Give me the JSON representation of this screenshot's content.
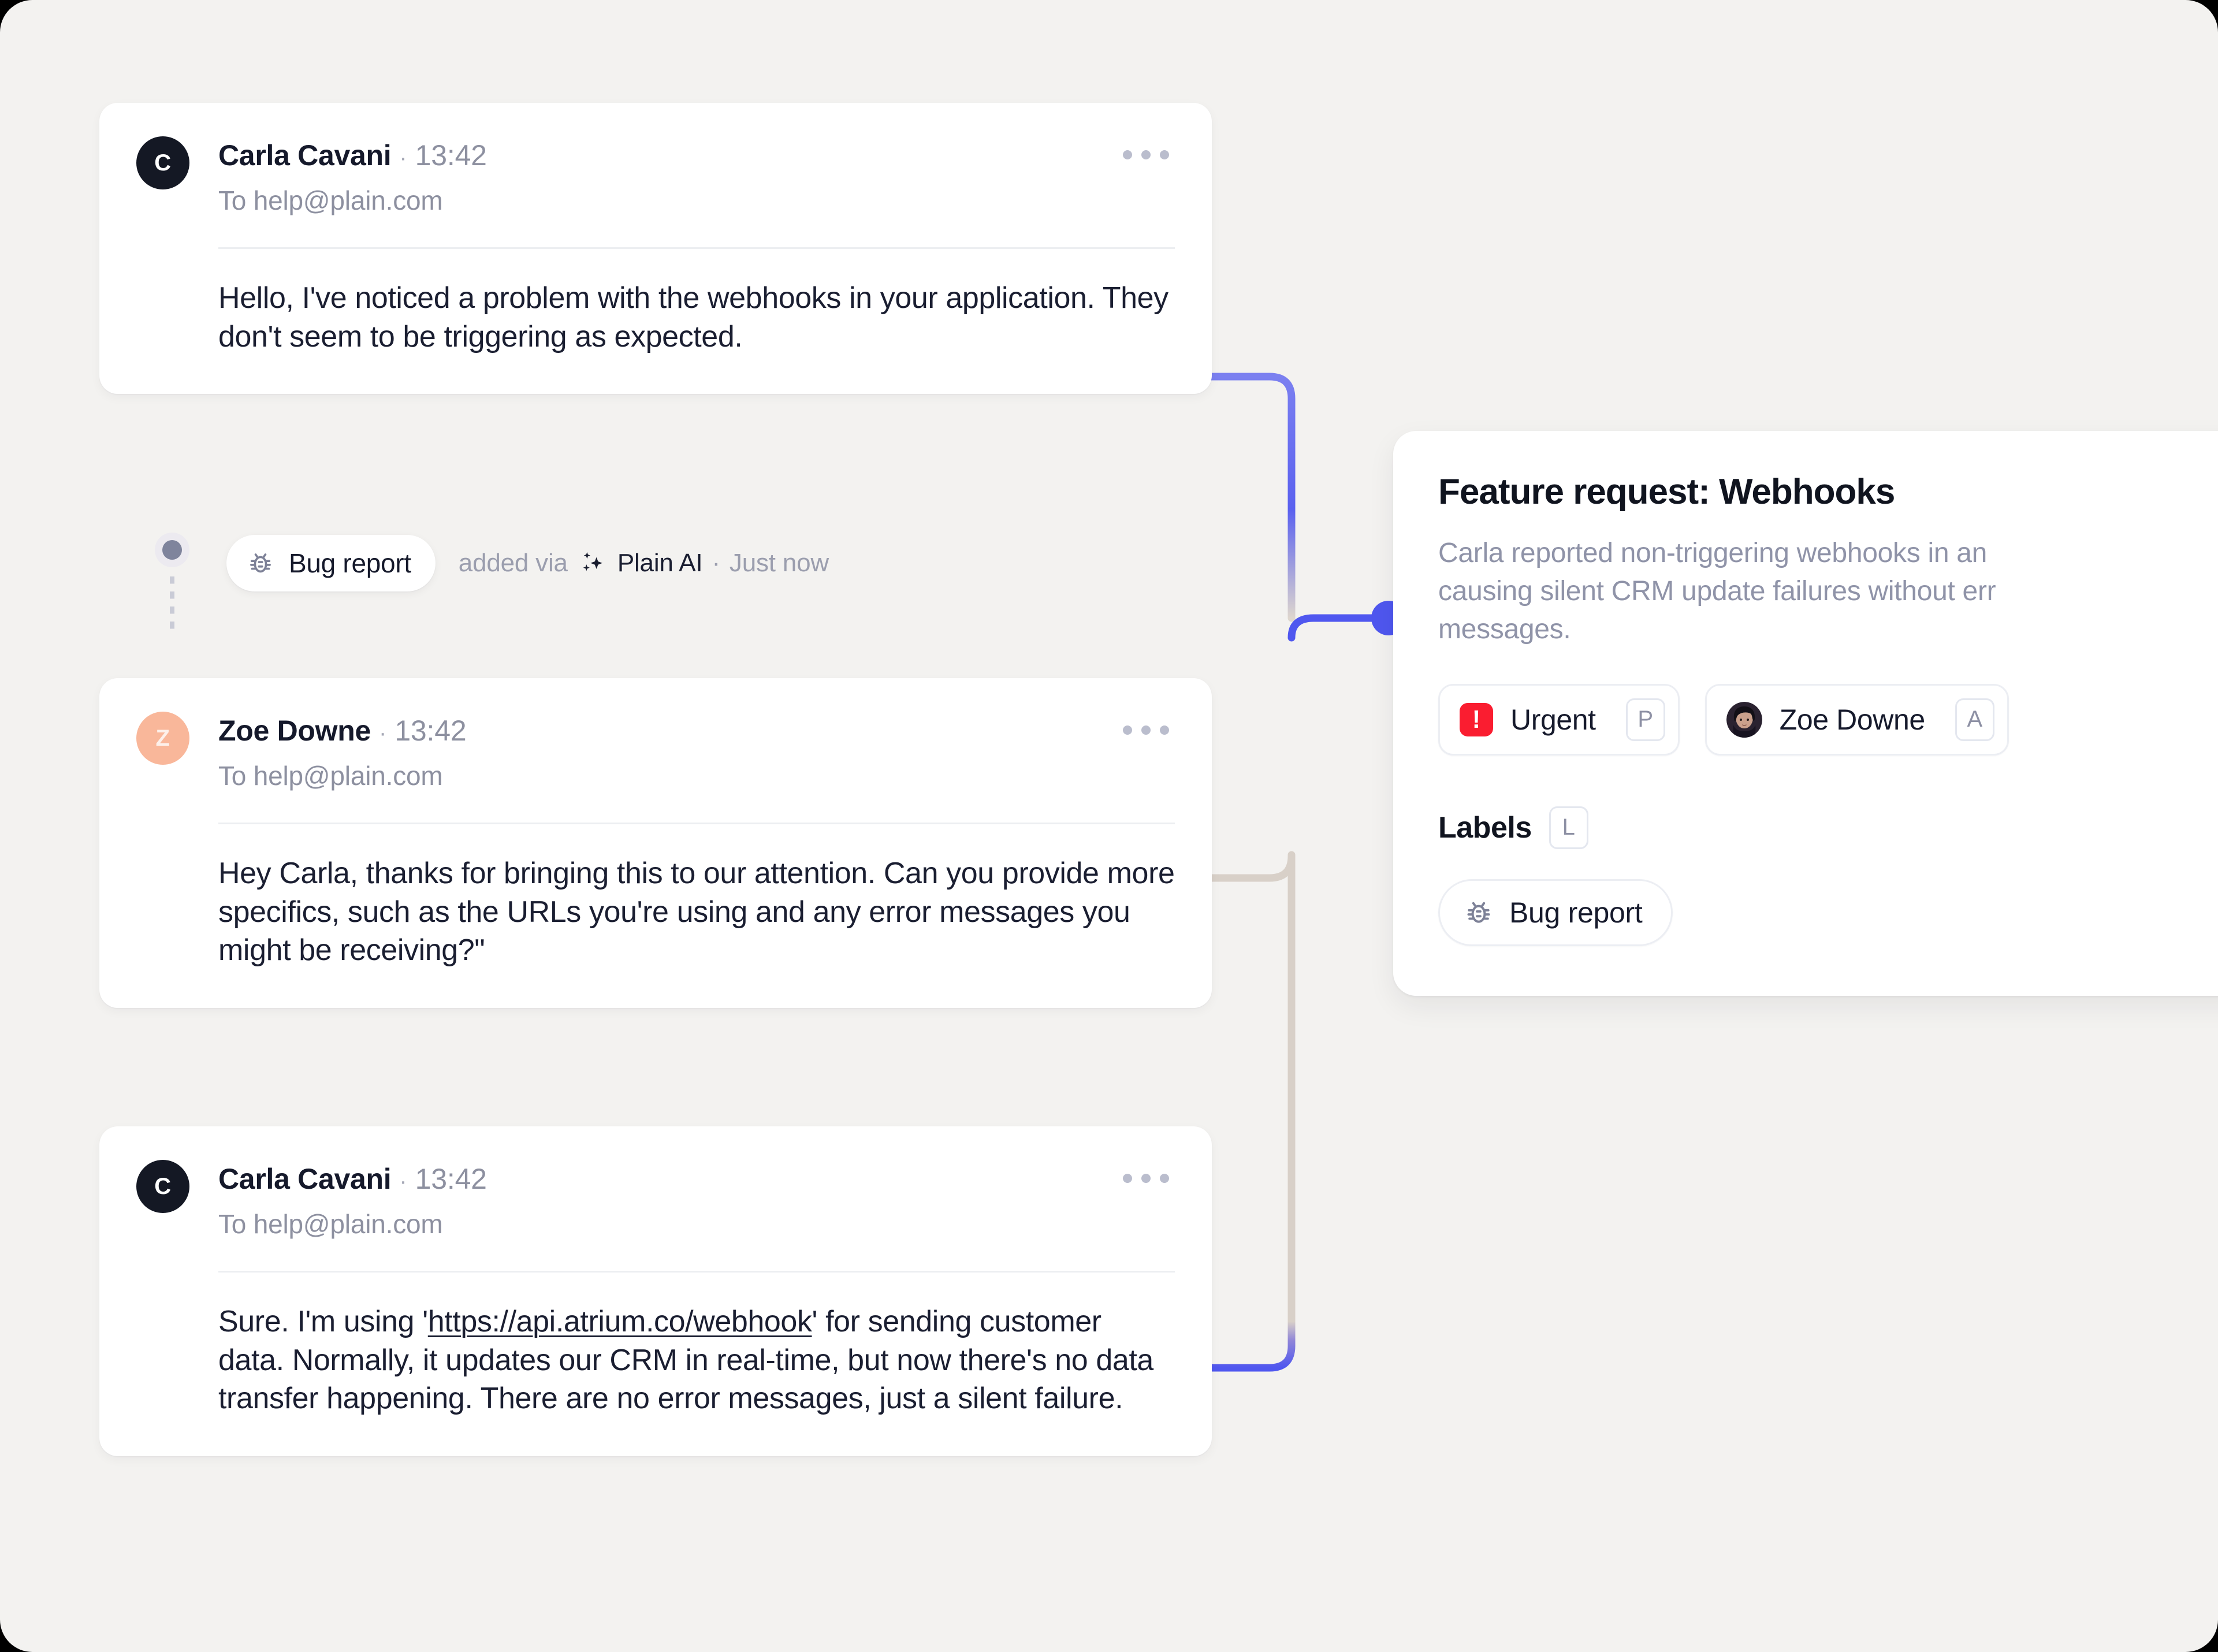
{
  "theme": {
    "canvas_bg": "#f3f2f0",
    "card_bg": "#ffffff",
    "accent_blue": "#4f57ef",
    "connector_neutral": "#d6cfc8",
    "urgent_red": "#fa1d30",
    "muted_text": "#8d90a0"
  },
  "thread": {
    "messages": [
      {
        "avatar_initial": "C",
        "avatar_style": "dark",
        "sender": "Carla Cavani",
        "separator": "·",
        "time": "13:42",
        "recipient": "To help@plain.com",
        "body_before": "Hello, I've noticed a problem with the webhooks in your application. They don't seem to be triggering as expected.",
        "link_text": "",
        "body_after": "",
        "menu_label": "More actions"
      },
      {
        "avatar_initial": "Z",
        "avatar_style": "peach",
        "sender": "Zoe Downe",
        "separator": "·",
        "time": "13:42",
        "recipient": "To help@plain.com",
        "body_before": "Hey Carla, thanks for bringing this to our attention. Can you provide more specifics, such as the URLs you're using and any error messages you might be receiving?\"",
        "link_text": "",
        "body_after": "",
        "menu_label": "More actions"
      },
      {
        "avatar_initial": "C",
        "avatar_style": "dark",
        "sender": "Carla Cavani",
        "separator": "·",
        "time": "13:42",
        "recipient": "To help@plain.com",
        "body_before": "Sure. I'm using '",
        "link_text": "https://api.atrium.co/webhook",
        "body_after": "' for sending customer data. Normally, it updates our CRM in real-time, but now there's no data transfer happening. There are no error messages, just a silent failure.",
        "menu_label": "More actions"
      }
    ],
    "event": {
      "badge_label": "Bug report",
      "badge_icon": "bug-icon",
      "meta_prefix": "added via",
      "source_icon": "sparkles-icon",
      "source_name": "Plain AI",
      "meta_separator": "·",
      "timestamp": "Just now"
    }
  },
  "panel": {
    "title": "Feature request: Webhooks",
    "description": "Carla reported non-triggering webhooks in an\ncausing silent CRM update failures without err\nmessages.",
    "priority_chip": {
      "icon": "priority-urgent-icon",
      "glyph": "!",
      "label": "Urgent",
      "shortcut": "P"
    },
    "assignee_chip": {
      "icon": "avatar-icon",
      "label": "Zoe Downe",
      "shortcut": "A"
    },
    "labels_section": {
      "title": "Labels",
      "shortcut": "L",
      "chips": [
        {
          "icon": "bug-icon",
          "label": "Bug report"
        }
      ]
    }
  }
}
